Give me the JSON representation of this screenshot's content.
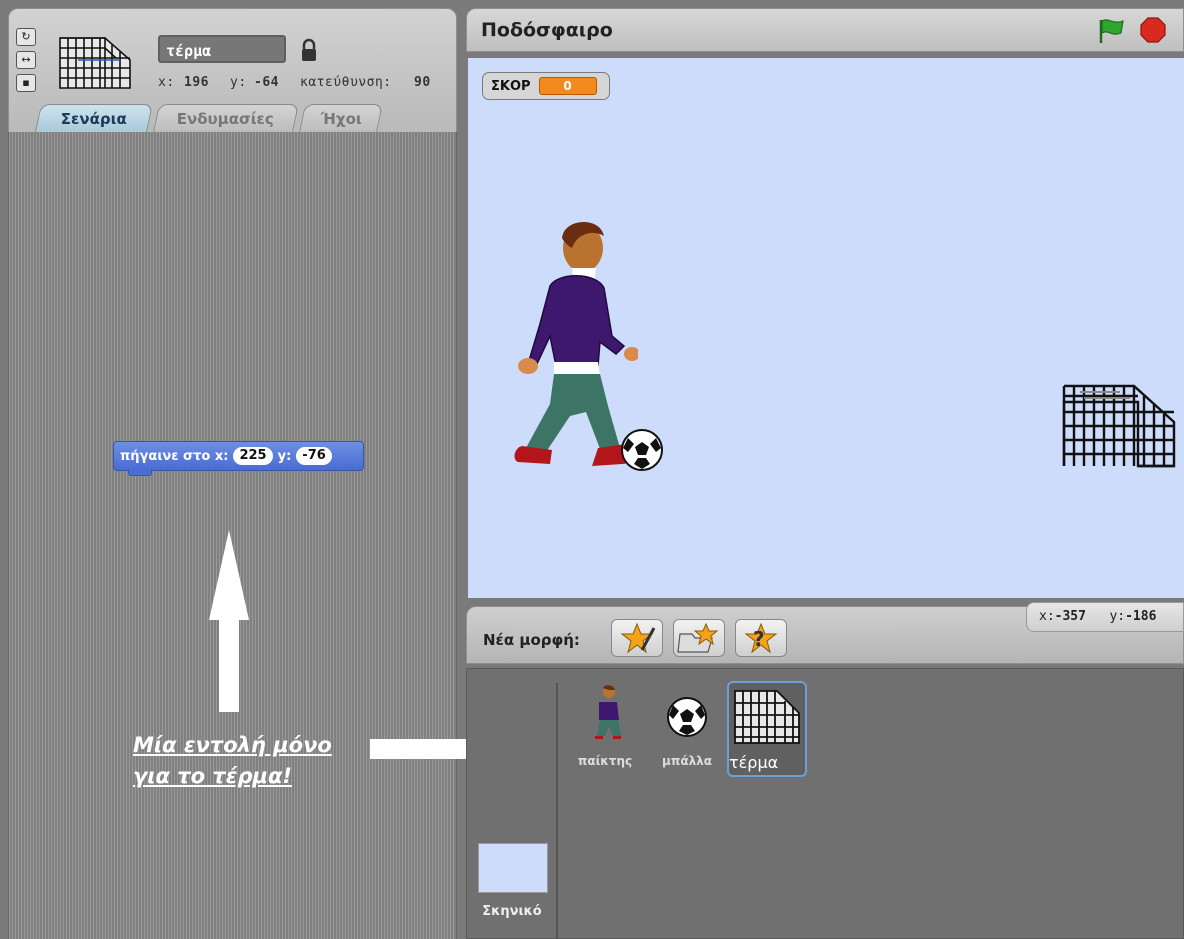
{
  "sprite": {
    "name": "τέρμα",
    "x_label": "x:",
    "x_value": "196",
    "y_label": "y:",
    "y_value": "-64",
    "direction_label": "κατεύθυνση:",
    "direction_value": "90"
  },
  "tabs": [
    {
      "label": "Σενάρια",
      "active": true
    },
    {
      "label": "Ενδυμασίες",
      "active": false
    },
    {
      "label": "Ήχοι",
      "active": false
    }
  ],
  "script_block": {
    "text_prefix": "πήγαινε στο x:",
    "x": "225",
    "text_mid": "y:",
    "y": "-76"
  },
  "annotation": {
    "line1": "Μία εντολή μόνο",
    "line2": "για το τέρμα!"
  },
  "stage": {
    "title": "Ποδόσφαιρο",
    "score_label": "ΣΚΟΡ",
    "score_value": "0",
    "background_color": "#cddcfb"
  },
  "new_sprite": {
    "label": "Νέα μορφή:"
  },
  "mouse": {
    "x_label": "x:",
    "x_value": "-357",
    "y_label": "y:",
    "y_value": "-186"
  },
  "corral": {
    "sprites": [
      {
        "name": "παίκτης"
      },
      {
        "name": "μπάλλα"
      },
      {
        "name": "τέρμα",
        "selected": true
      }
    ],
    "backdrop_label": "Σκηνικό"
  },
  "colors": {
    "motion_block": "#4a6cd4",
    "score_orange": "#f28a1f",
    "green_flag": "#2da82d",
    "stop_sign": "#d92a1f",
    "selected_border": "#6aa0d8"
  },
  "icons": [
    "rotate-icon",
    "flip-icon",
    "no-rotate-icon",
    "lock-icon",
    "green-flag-icon",
    "stop-icon",
    "paint-sprite-icon",
    "choose-sprite-icon",
    "surprise-sprite-icon",
    "arrow-up-icon",
    "arrow-right-icon"
  ]
}
